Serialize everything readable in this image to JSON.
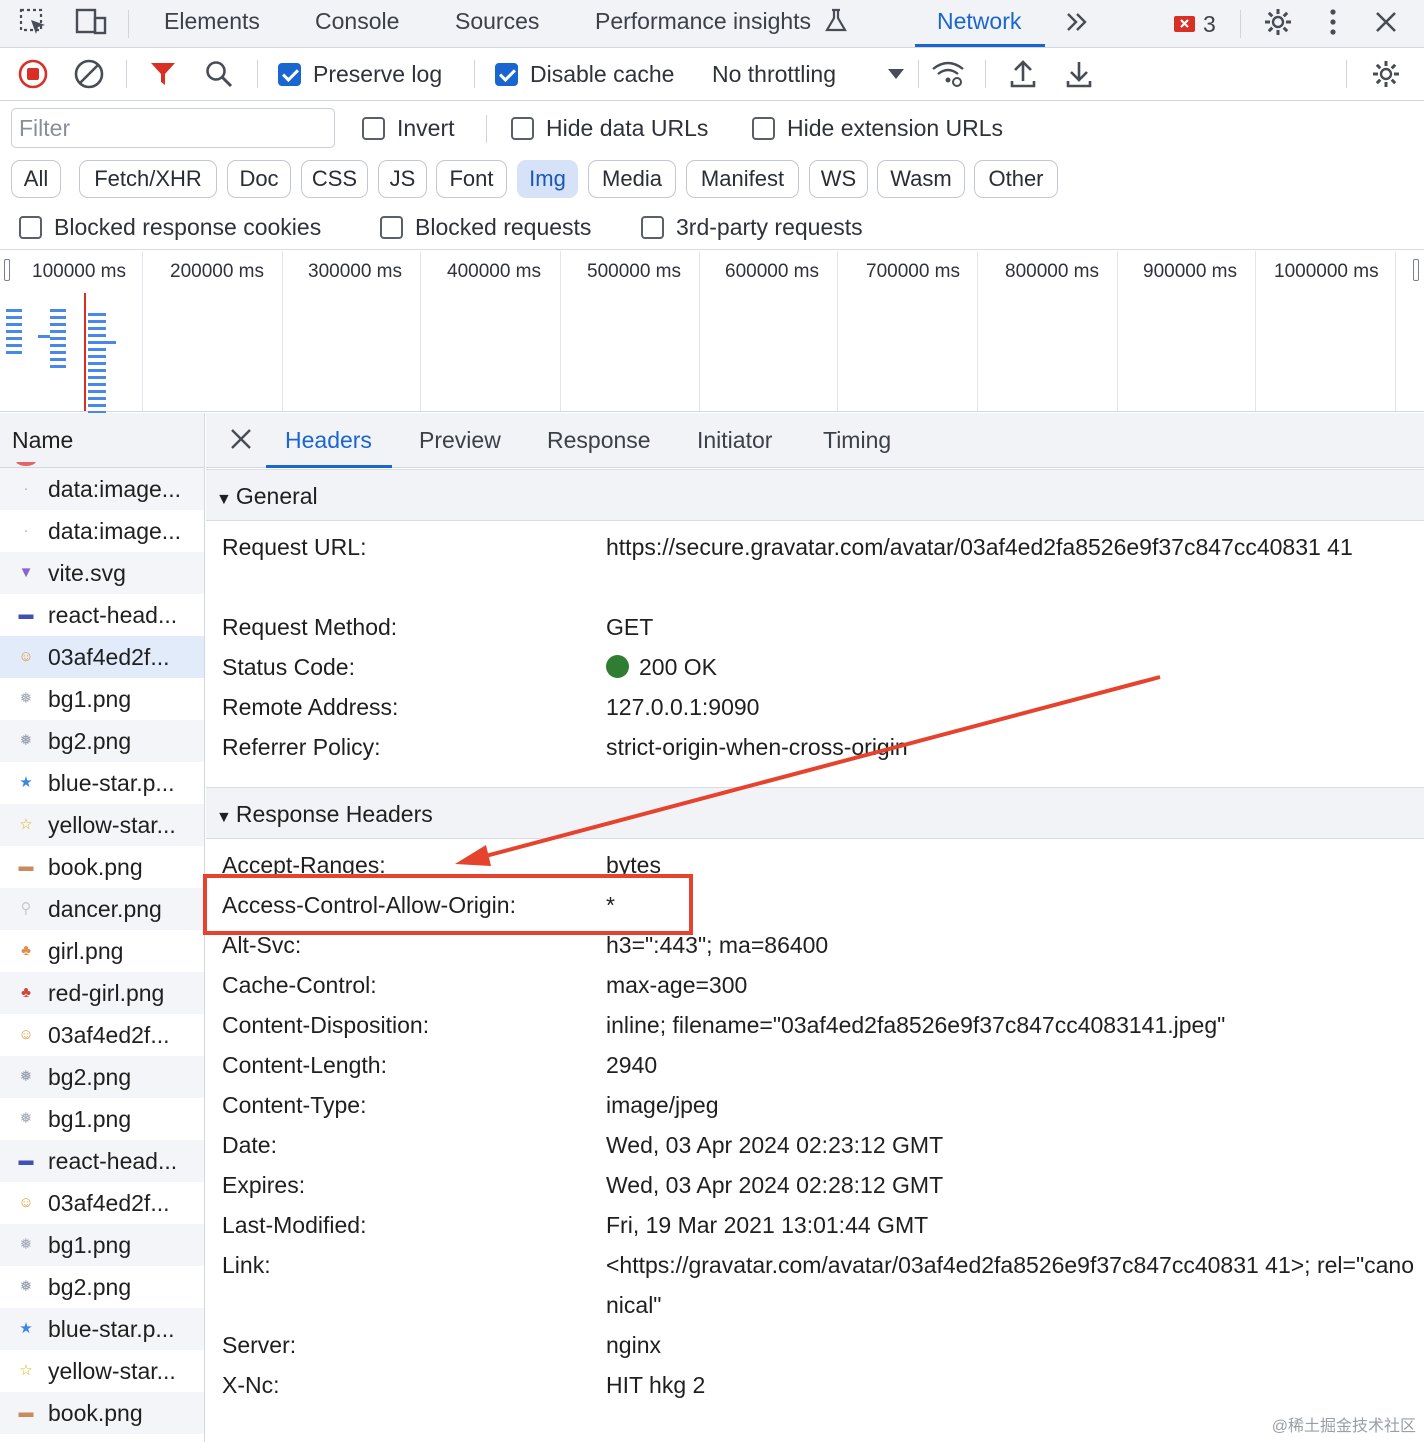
{
  "top_tabs": [
    "Elements",
    "Console",
    "Sources",
    "Performance insights",
    "Network"
  ],
  "issues_count": "3",
  "toolbar": {
    "preserve_log": "Preserve log",
    "disable_cache": "Disable cache",
    "throttling": "No throttling"
  },
  "filter": {
    "placeholder": "Filter",
    "invert": "Invert",
    "hide_data_urls": "Hide data URLs",
    "hide_extension_urls": "Hide extension URLs"
  },
  "type_chips": [
    "All",
    "Fetch/XHR",
    "Doc",
    "CSS",
    "JS",
    "Font",
    "Img",
    "Media",
    "Manifest",
    "WS",
    "Wasm",
    "Other"
  ],
  "selected_chip": "Img",
  "block_filters": {
    "blocked_response_cookies": "Blocked response cookies",
    "blocked_requests": "Blocked requests",
    "third_party": "3rd-party requests"
  },
  "timeline_ticks": [
    "100000 ms",
    "200000 ms",
    "300000 ms",
    "400000 ms",
    "500000 ms",
    "600000 ms",
    "700000 ms",
    "800000 ms",
    "900000 ms",
    "1000000 ms"
  ],
  "name_header": "Name",
  "requests": [
    "data:image...",
    "data:image...",
    "vite.svg",
    "react-head...",
    "03af4ed2f...",
    "bg1.png",
    "bg2.png",
    "blue-star.p...",
    "yellow-star...",
    "book.png",
    "dancer.png",
    "girl.png",
    "red-girl.png",
    "03af4ed2f...",
    "bg2.png",
    "bg1.png",
    "react-head...",
    "03af4ed2f...",
    "bg1.png",
    "bg2.png",
    "blue-star.p...",
    "yellow-star...",
    "book.png"
  ],
  "detail_tabs": [
    "Headers",
    "Preview",
    "Response",
    "Initiator",
    "Timing"
  ],
  "general": {
    "title": "General",
    "rows": [
      {
        "k": "Request URL:",
        "v": "https://secure.gravatar.com/avatar/03af4ed2fa8526e9f37c847cc40831 41"
      },
      {
        "k": "Request Method:",
        "v": "GET"
      },
      {
        "k": "Status Code:",
        "v": "200 OK"
      },
      {
        "k": "Remote Address:",
        "v": "127.0.0.1:9090"
      },
      {
        "k": "Referrer Policy:",
        "v": "strict-origin-when-cross-origin"
      }
    ]
  },
  "response_headers": {
    "title": "Response Headers",
    "rows": [
      {
        "k": "Accept-Ranges:",
        "v": "bytes"
      },
      {
        "k": "Access-Control-Allow-Origin:",
        "v": "*"
      },
      {
        "k": "Alt-Svc:",
        "v": "h3=\":443\"; ma=86400"
      },
      {
        "k": "Cache-Control:",
        "v": "max-age=300"
      },
      {
        "k": "Content-Disposition:",
        "v": "inline; filename=\"03af4ed2fa8526e9f37c847cc4083141.jpeg\""
      },
      {
        "k": "Content-Length:",
        "v": "2940"
      },
      {
        "k": "Content-Type:",
        "v": "image/jpeg"
      },
      {
        "k": "Date:",
        "v": "Wed, 03 Apr 2024 02:23:12 GMT"
      },
      {
        "k": "Expires:",
        "v": "Wed, 03 Apr 2024 02:28:12 GMT"
      },
      {
        "k": "Last-Modified:",
        "v": "Fri, 19 Mar 2021 13:01:44 GMT"
      },
      {
        "k": "Link:",
        "v": "<https://gravatar.com/avatar/03af4ed2fa8526e9f37c847cc40831 41>; rel=\"canonical\""
      },
      {
        "k": "Server:",
        "v": "nginx"
      },
      {
        "k": "X-Nc:",
        "v": "HIT hkg 2"
      }
    ]
  },
  "watermark": "@稀土掘金技术社区",
  "colors": {
    "accent": "#1a66d1",
    "annotation": "#e5432e",
    "status_ok": "#2e7d32"
  }
}
